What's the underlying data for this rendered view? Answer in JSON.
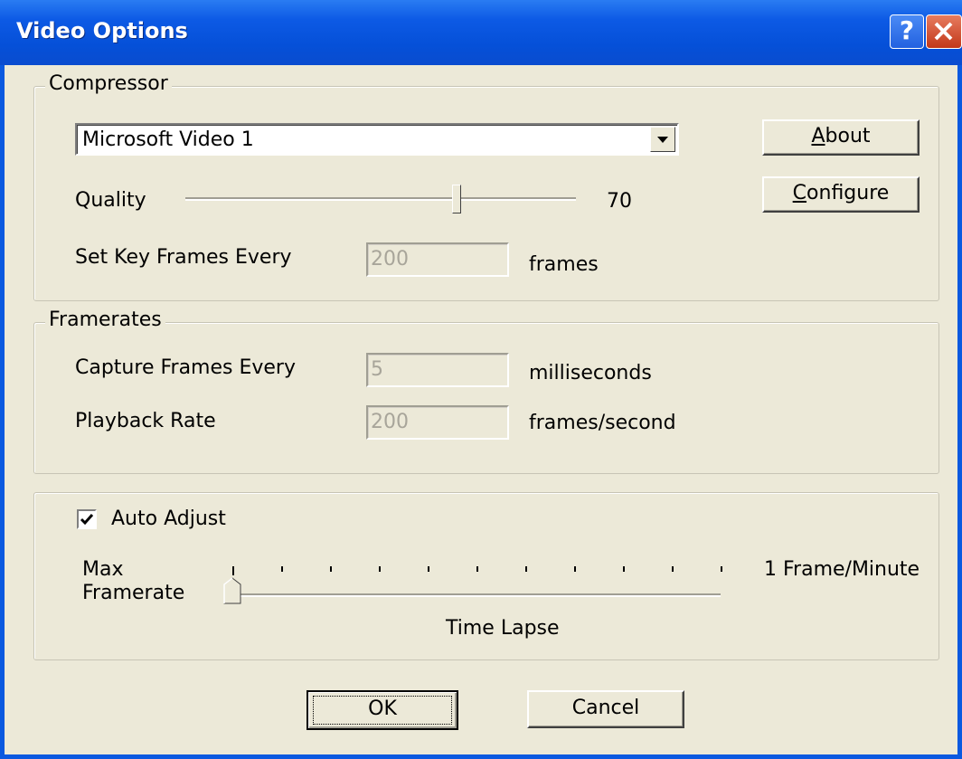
{
  "window": {
    "title": "Video Options"
  },
  "titlebar_buttons": {
    "help": "?",
    "close": "✕"
  },
  "compressor": {
    "legend": "Compressor",
    "codec_selected": "Microsoft Video 1",
    "about_label": "About",
    "about_mnemonic": "A",
    "about_rest": "bout",
    "configure_label": "Configure",
    "configure_mnemonic": "C",
    "configure_rest": "onfigure",
    "quality_label": "Quality",
    "quality_value": "70",
    "quality_level": 70,
    "keyframes_label": "Set Key Frames Every",
    "keyframes_value": "200",
    "keyframes_unit": "frames"
  },
  "framerates": {
    "legend": "Framerates",
    "capture_label": "Capture Frames Every",
    "capture_value": "5",
    "capture_unit": "milliseconds",
    "playback_label": "Playback Rate",
    "playback_value": "200",
    "playback_unit": "frames/second"
  },
  "auto": {
    "checkbox_label": "Auto Adjust",
    "checked": true,
    "max_label_line1": "Max",
    "max_label_line2": "Framerate",
    "right_label": "1 Frame/Minute",
    "bottom_label": "Time Lapse",
    "slider_level": 0
  },
  "buttons": {
    "ok": "OK",
    "cancel": "Cancel"
  },
  "colors": {
    "titlebar": "#0550d8",
    "face": "#ece9d8",
    "close": "#c2381a"
  }
}
